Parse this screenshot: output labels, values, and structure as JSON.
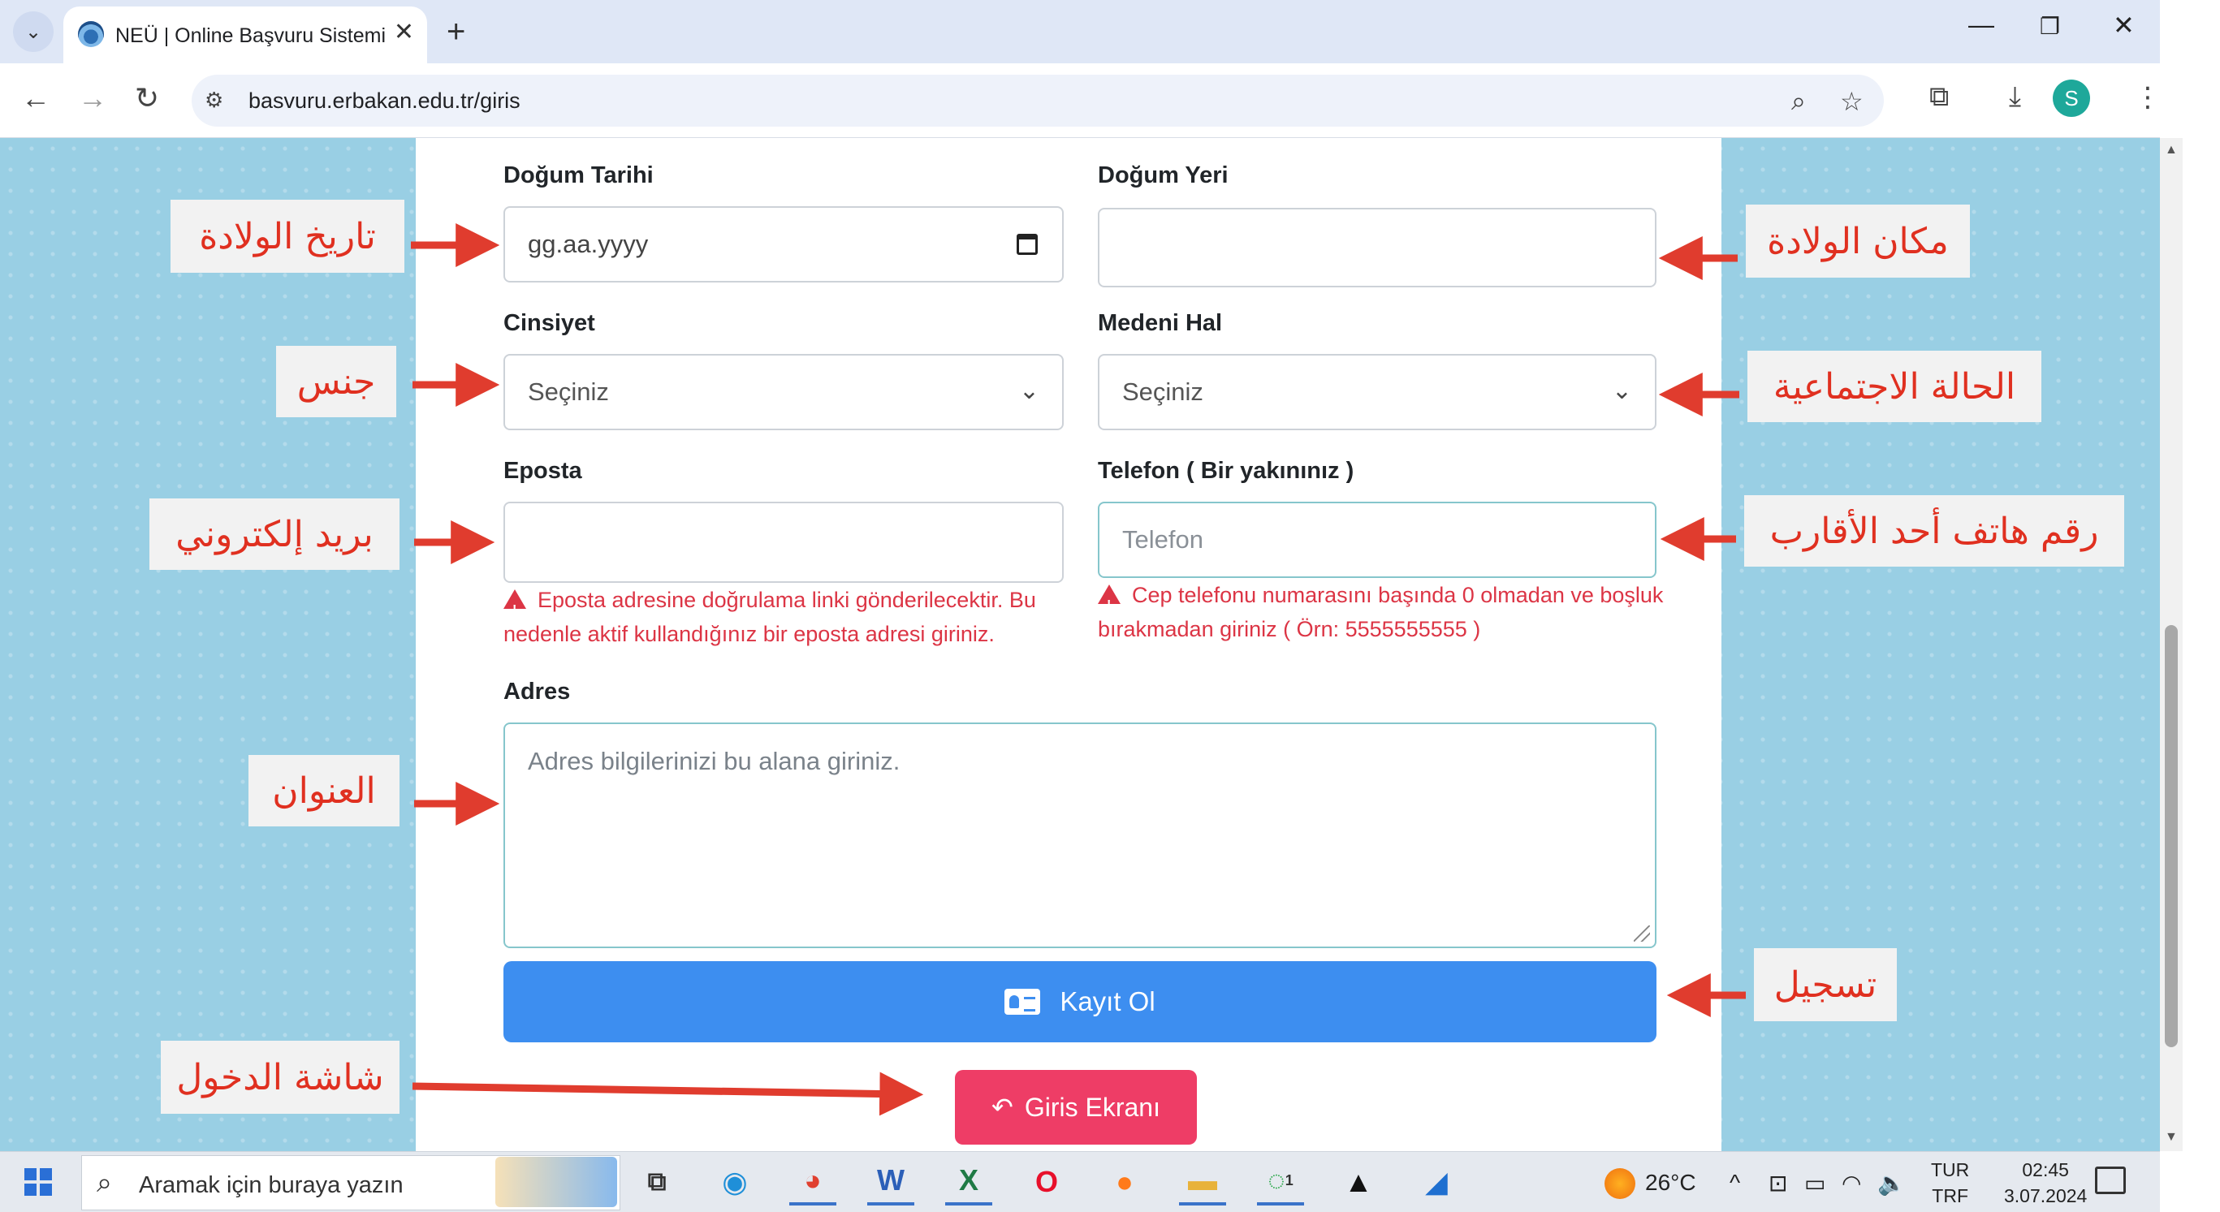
{
  "browser": {
    "tab_title": "NEÜ | Online Başvuru Sistemi",
    "url": "basvuru.erbakan.edu.tr/giris",
    "profile_initial": "S"
  },
  "form": {
    "birth_date_label": "Doğum Tarihi",
    "birth_date_placeholder": "gg.aa.yyyy",
    "birth_place_label": "Doğum Yeri",
    "birth_place_value": "",
    "gender_label": "Cinsiyet",
    "gender_value": "Seçiniz",
    "marital_label": "Medeni Hal",
    "marital_value": "Seçiniz",
    "email_label": "Eposta",
    "email_value": "",
    "email_hint": "Eposta adresine doğrulama linki gönderilecektir. Bu nedenle aktif kullandığınız bir eposta adresi giriniz.",
    "phone_label": "Telefon ( Bir yakınınız )",
    "phone_placeholder": "Telefon",
    "phone_hint": "Cep telefonu numarasını başında 0 olmadan ve boşluk bırakmadan giriniz ( Örn: 5555555555 )",
    "address_label": "Adres",
    "address_placeholder": "Adres bilgilerinizi bu alana giriniz.",
    "register_button": "Kayıt Ol",
    "login_button": "Giris Ekranı"
  },
  "annotations": {
    "birth_date": "تاريخ الولادة",
    "birth_place": "مكان الولادة",
    "gender": "جنس",
    "marital": "الحالة الاجتماعية",
    "email": "بريد إلكتروني",
    "phone": "رقم هاتف أحد الأقارب",
    "address": "العنوان",
    "register": "تسجيل",
    "login": "شاشة الدخول"
  },
  "taskbar": {
    "search_placeholder": "Aramak için buraya yazın",
    "temperature": "26°C",
    "lang_1": "TUR",
    "lang_2": "TRF",
    "time": "02:45",
    "date": "3.07.2024",
    "whatsapp_badge": "1"
  },
  "colors": {
    "primary_button": "#3d8ef0",
    "danger_button": "#ee3d66",
    "hint_text": "#dc3545",
    "annotation_text": "#e03020",
    "page_background": "#99cfe4"
  }
}
